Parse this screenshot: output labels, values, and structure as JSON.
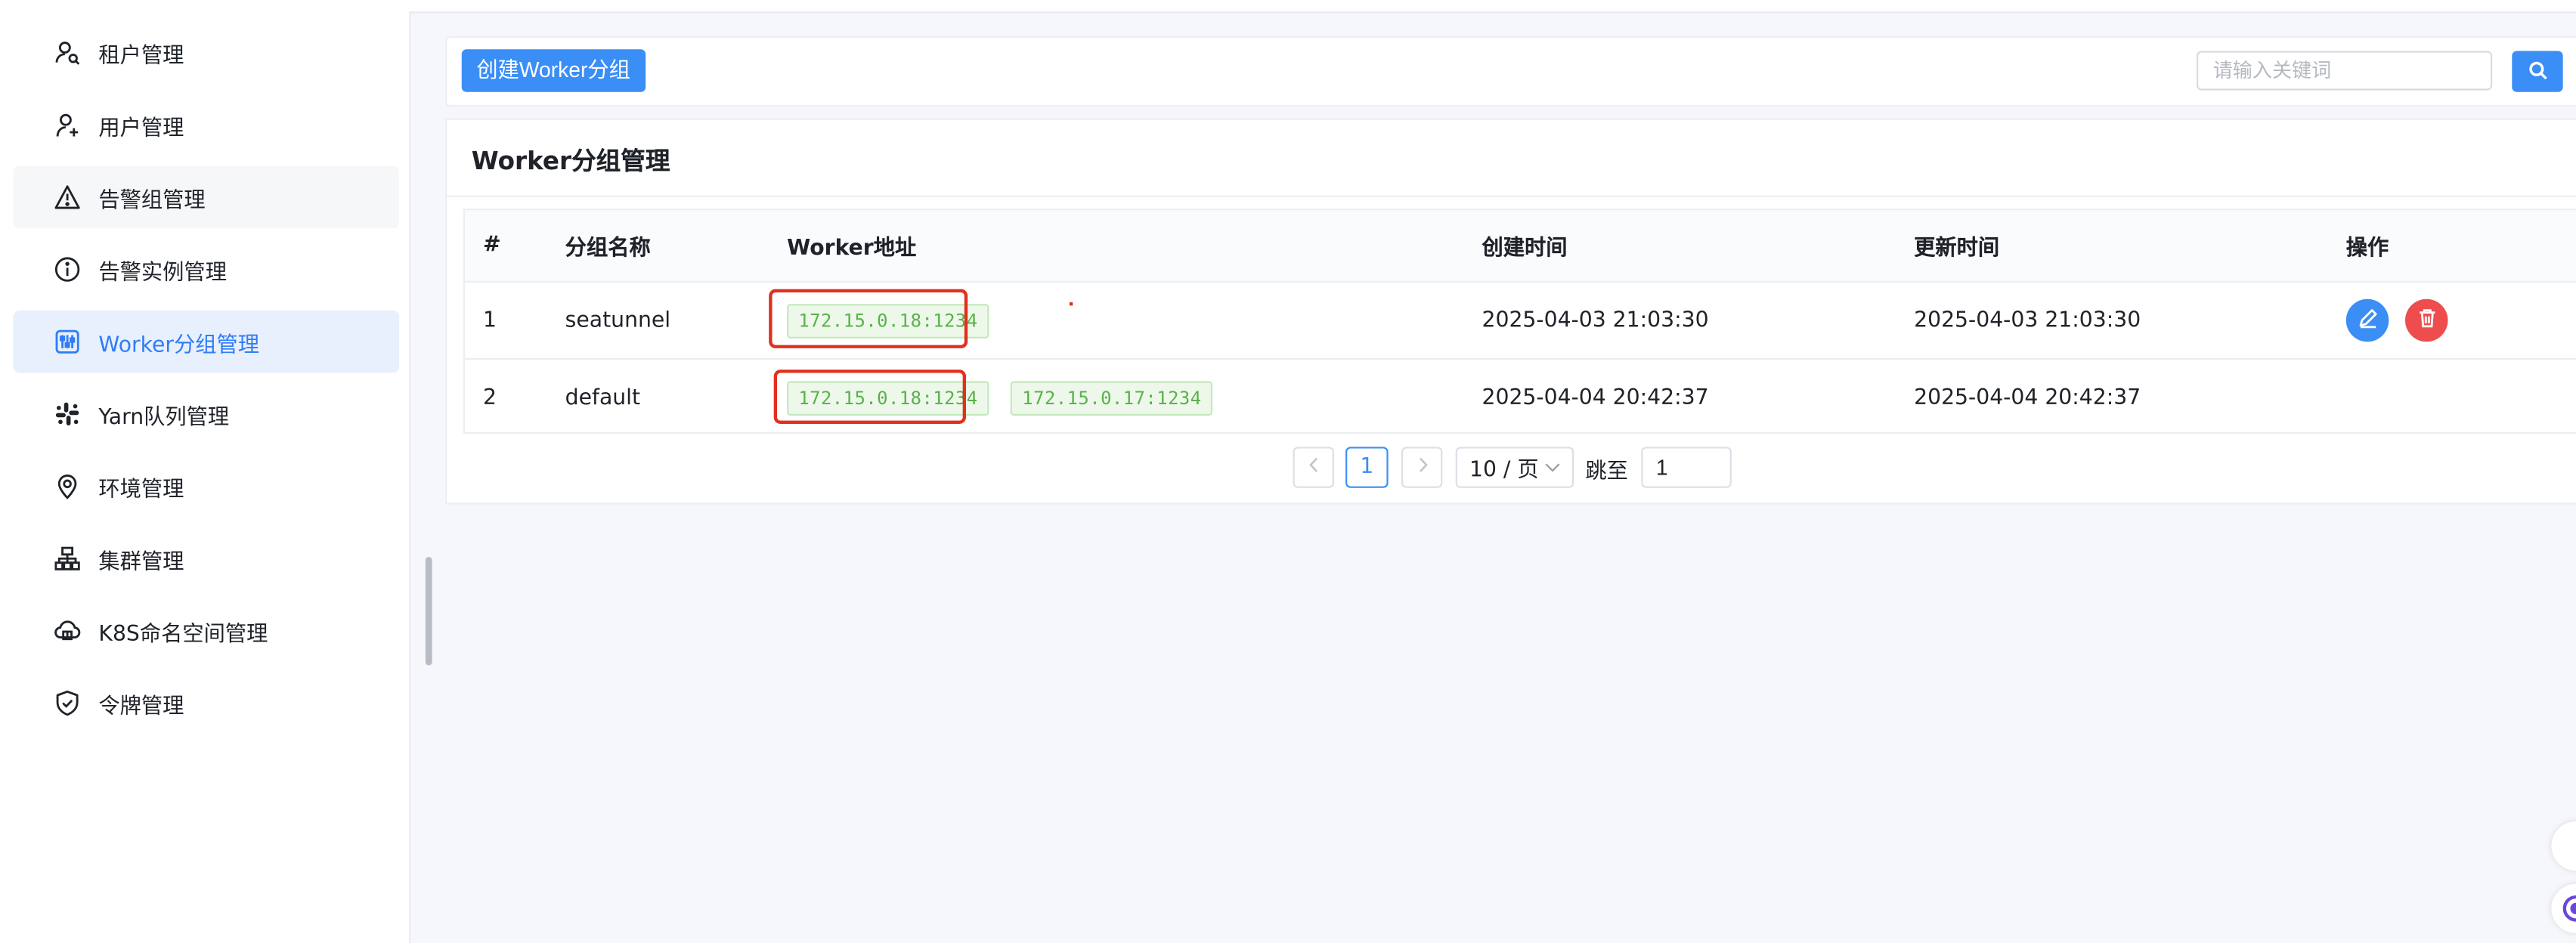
{
  "sidebar": {
    "items": [
      {
        "label": "租户管理",
        "icon": "tenant-icon"
      },
      {
        "label": "用户管理",
        "icon": "user-add-icon"
      },
      {
        "label": "告警组管理",
        "icon": "warning-icon"
      },
      {
        "label": "告警实例管理",
        "icon": "info-icon"
      },
      {
        "label": "Worker分组管理",
        "icon": "sliders-icon",
        "active": true
      },
      {
        "label": "Yarn队列管理",
        "icon": "slack-icon"
      },
      {
        "label": "环境管理",
        "icon": "location-icon"
      },
      {
        "label": "集群管理",
        "icon": "cluster-icon"
      },
      {
        "label": "K8S命名空间管理",
        "icon": "cloud-icon"
      },
      {
        "label": "令牌管理",
        "icon": "shield-check-icon"
      }
    ]
  },
  "toolbar": {
    "create_label": "创建Worker分组",
    "search_placeholder": "请输入关键词",
    "search_icon": "search-icon"
  },
  "card": {
    "title": "Worker分组管理"
  },
  "table": {
    "columns": [
      "#",
      "分组名称",
      "Worker地址",
      "创建时间",
      "更新时间",
      "操作"
    ],
    "rows": [
      {
        "index": "1",
        "name": "seatunnel",
        "addresses": [
          "172.15.0.18:1234"
        ],
        "created": "2025-04-03 21:03:30",
        "updated": "2025-04-03 21:03:30",
        "actions": [
          "edit-icon",
          "delete-icon"
        ]
      },
      {
        "index": "2",
        "name": "default",
        "addresses": [
          "172.15.0.18:1234",
          "172.15.0.17:1234"
        ],
        "created": "2025-04-04 20:42:37",
        "updated": "2025-04-04 20:42:37",
        "actions": []
      }
    ]
  },
  "pagination": {
    "current_page": "1",
    "page_size": "10 / 页",
    "jump_label": "跳至",
    "jump_value": "1"
  },
  "colors": {
    "primary": "#3a8ef6",
    "danger": "#ee4d4d",
    "tag_green": "#59b24b",
    "highlight_red": "#e0301e"
  }
}
